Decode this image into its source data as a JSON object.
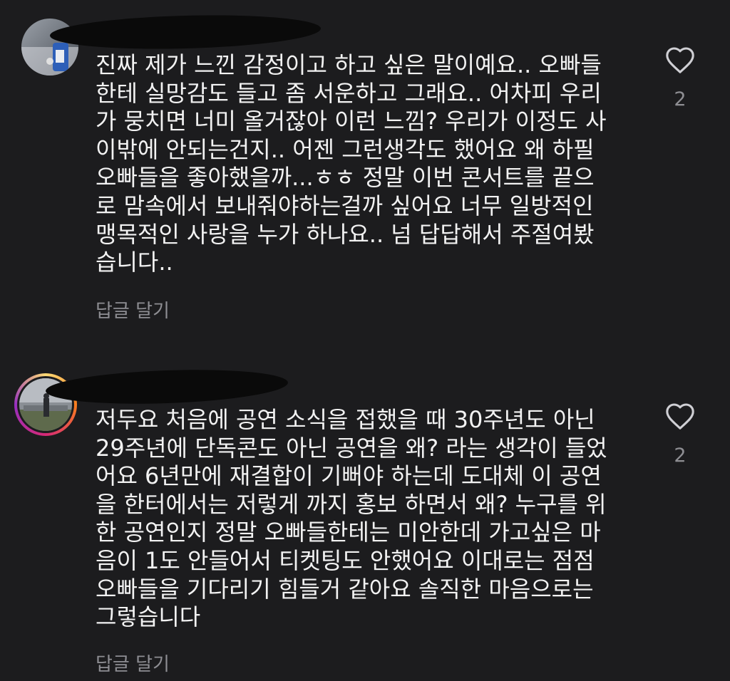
{
  "comments": [
    {
      "text": "진짜 제가 느낀 감정이고 하고 싶은 말이예요.. 오빠들\n한테 실망감도 들고 좀 서운하고 그래요.. 어차피 우리\n가 뭉치면 너미 올거잖아 이런 느낌? 우리가 이정도 사\n이밖에 안되는건지.. 어젠 그런생각도 했어요 왜 하필\n오빠들을 좋아했을까...ㅎㅎ 정말 이번 콘서트를 끝으\n로 맘속에서 보내줘야하는걸까 싶어요 너무 일방적인\n맹목적인 사랑을 누가 하나요.. 넘 답답해서 주절여봤\n습니다..",
      "reply_label": "답글 달기",
      "like_count": "2",
      "like_icon": "heart-outline-icon"
    },
    {
      "text": "저두요 처음에 공연 소식을 접했을 때 30주년도 아닌\n29주년에 단독콘도 아닌 공연을 왜? 라는 생각이 들었\n어요 6년만에 재결합이 기뻐야 하는데 도대체 이 공연\n을 한터에서는 저렇게 까지 홍보 하면서 왜? 누구를 위\n한 공연인지 정말 오빠들한테는 미안한데 가고싶은 마\n음이 1도 안들어서 티켓팅도 안했어요 이대로는 점점\n오빠들을 기다리기 힘들거 같아요 솔직한 마음으로는\n그렇습니다",
      "reply_label": "답글 달기",
      "like_count": "2",
      "like_icon": "heart-outline-icon"
    }
  ],
  "colors": {
    "background": "#1c1c1e",
    "text": "#f2f2f2",
    "muted": "#8e8e93",
    "story_ring": [
      "#feda75",
      "#fa7e1e",
      "#d62976",
      "#962fbf"
    ]
  }
}
